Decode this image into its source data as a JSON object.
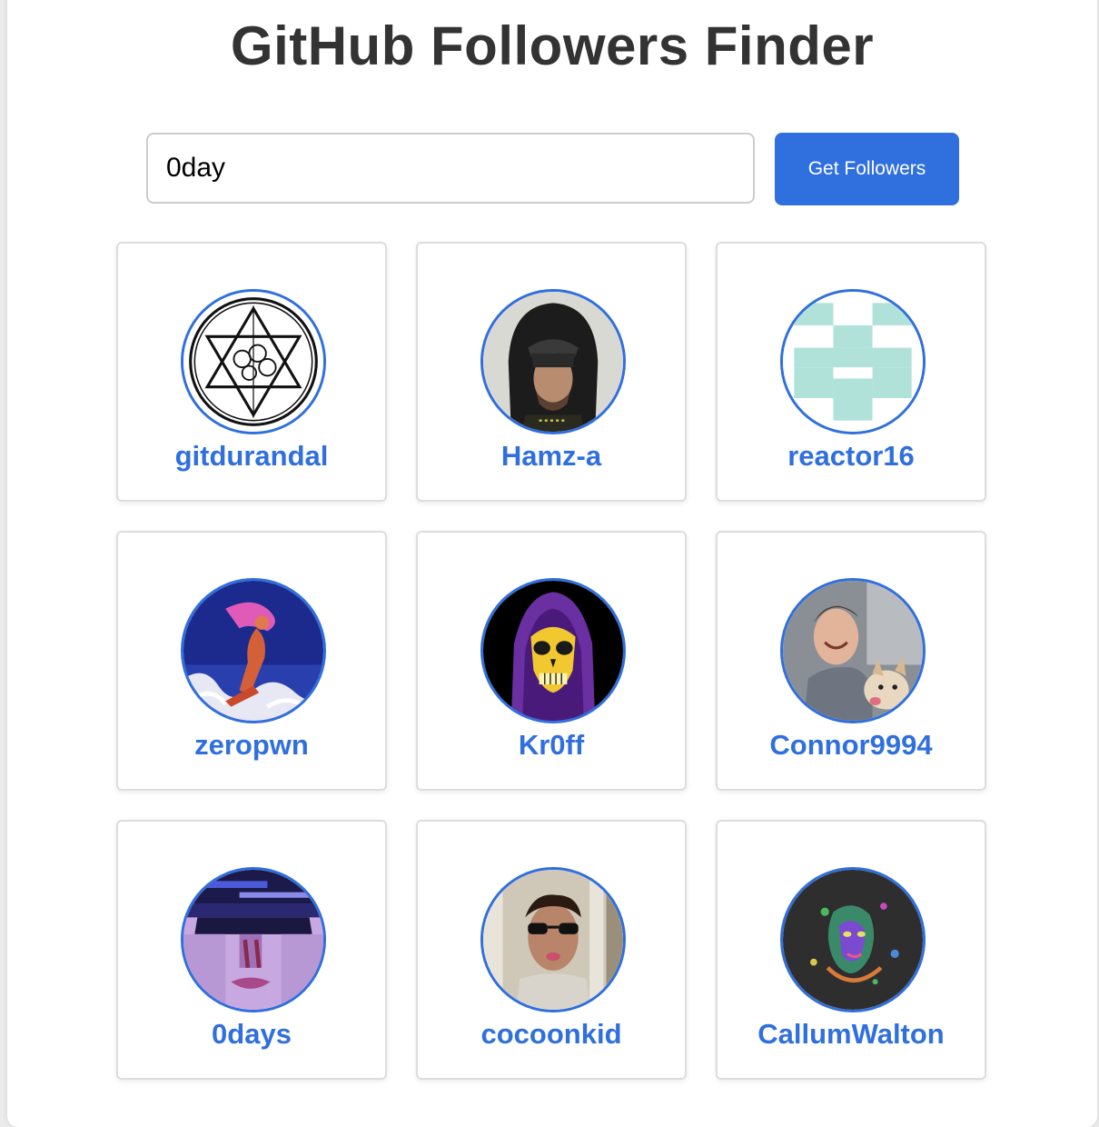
{
  "app": {
    "title": "GitHub Followers Finder"
  },
  "search": {
    "value": "0day",
    "button_label": "Get Followers"
  },
  "theme": {
    "accent": "#2f6fde",
    "title_color": "#333333",
    "card_border": "#dddddd"
  },
  "followers": [
    {
      "username": "gitdurandal",
      "avatar_icon": "hexagram-circle-avatar"
    },
    {
      "username": "Hamz-a",
      "avatar_icon": "hooded-person-avatar"
    },
    {
      "username": "reactor16",
      "avatar_icon": "identicon-avatar"
    },
    {
      "username": "zeropwn",
      "avatar_icon": "pixel-art-figure-avatar"
    },
    {
      "username": "Kr0ff",
      "avatar_icon": "skeletor-avatar"
    },
    {
      "username": "Connor9994",
      "avatar_icon": "man-with-dog-avatar"
    },
    {
      "username": "0days",
      "avatar_icon": "pixel-face-avatar"
    },
    {
      "username": "cocoonkid",
      "avatar_icon": "man-sunglasses-avatar"
    },
    {
      "username": "CallumWalton",
      "avatar_icon": "psychedelic-face-avatar"
    }
  ]
}
